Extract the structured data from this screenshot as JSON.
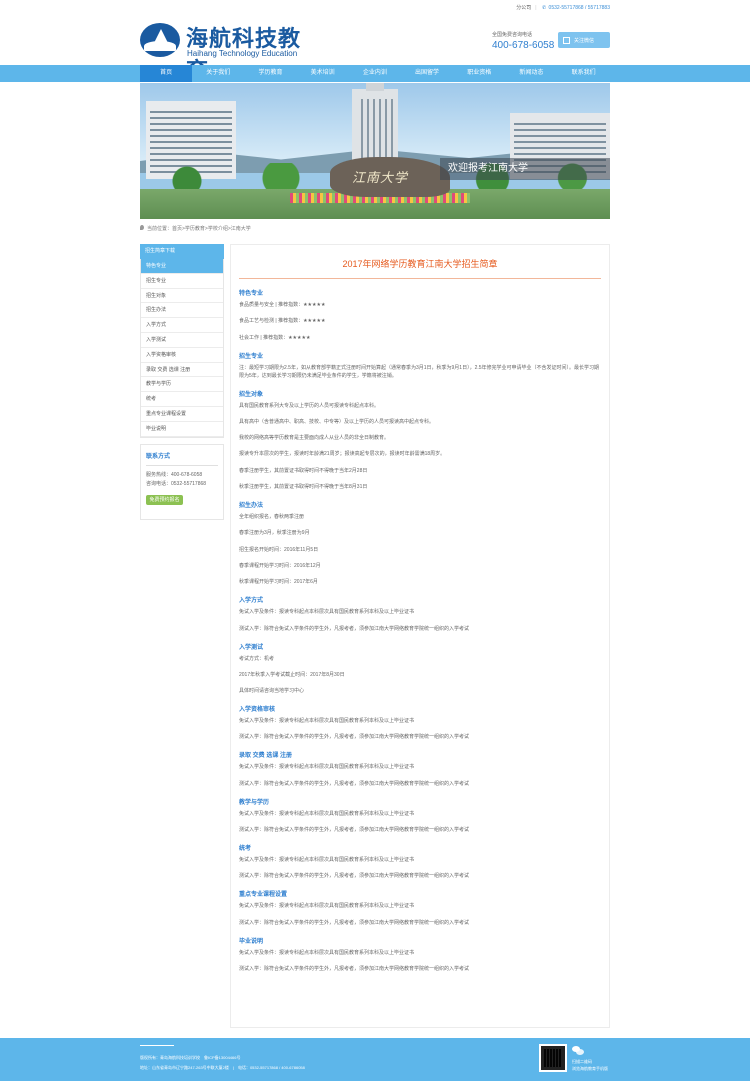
{
  "topbar": {
    "branch": "分公司",
    "tel": "0532-55717868 / 55717883"
  },
  "header": {
    "logo_cn": "海航科技教育",
    "logo_en": "Haihang Technology Education",
    "hotline_label": "全国免费咨询电话",
    "hotline": "400-678-6058",
    "follow": "关注微信"
  },
  "nav": [
    "首页",
    "关于我们",
    "学历教育",
    "美术培训",
    "企业内训",
    "出国留学",
    "职业资格",
    "新闻动态",
    "联系我们"
  ],
  "banner": {
    "calligraphy": "江南大学",
    "welcome": "欢迎报考江南大学"
  },
  "breadcrumb": "当前位置：首页>学历教育>学校介绍>江南大学",
  "sidebar": {
    "download": "招生简章下载",
    "items": [
      "特色专业",
      "招生专业",
      "招生对象",
      "招生办法",
      "入学方式",
      "入学测试",
      "入学资格审核",
      "录取 交费 选课 注册",
      "教学与学历",
      "统考",
      "重点专业课程设置",
      "毕业说明"
    ],
    "contact_title": "联系方式",
    "contact_lines": [
      "服务热线：400-678-6058",
      "咨询电话：0532-55717868"
    ],
    "contact_button": "免费预约报名"
  },
  "article": {
    "title": "2017年网络学历教育江南大学招生简章",
    "sections": [
      {
        "heading": "特色专业",
        "lines": [
          "食品质量与安全 | 推荐指数：★★★★★",
          "食品工艺与检测 | 推荐指数：★★★★★",
          "社会工作 | 推荐指数：★★★★★"
        ]
      },
      {
        "heading": "招生专业",
        "lines": [
          "注：最短学习期限为2.5年，如从教育部学籍正式注册时间开始算起（通常春季为3月1日，秋季为9月1日），2.5年修完学业可申请毕业（不含发证时间）。最长学习期限为5年，达到最长学习期限仍未满足毕业条件的学生，学籍将被注销。"
        ]
      },
      {
        "heading": "招生对象",
        "lines": [
          "具有国民教育系列大专及以上学历的人员可报读专科起点本科。",
          "具有高中（含普通高中、职高、技校、中专等）及以上学历的人员可报读高中起点专科。",
          "我校的网络高等学历教育是主要面向成人从业人员的非全日制教育。",
          "报读专升本层次的学生，报读时年龄满21周岁；报读高起专层次的，报读时年龄需满18周岁。",
          "春季注册学生，其前置证书取得时间不得晚于当年2月28日",
          "秋季注册学生，其前置证书取得时间不得晚于当年8月31日"
        ]
      },
      {
        "heading": "招生办法",
        "lines": [
          "全年组织报名，春秋两季注册",
          "春季注册为3月，秋季注册为9月",
          "招生报名开始时间：2016年11月5日",
          "春季课程开始学习时间：2016年12月",
          "秋季课程开始学习时间：2017年6月"
        ]
      },
      {
        "heading": "入学方式",
        "lines": [
          "免试入学及条件：报读专科起点本科层次具有国民教育系列本科及以上毕业证书",
          "测试入学：除符合免试入学条件的学生外，凡报考者，须参加江南大学网络教育学院统一组织的入学考试"
        ]
      },
      {
        "heading": "入学测试",
        "lines": [
          "考试方式：机考",
          "2017年秋季入学考试截止时间：2017年8月30日",
          "具体时间请咨询当地学习中心"
        ]
      },
      {
        "heading": "入学资格审核",
        "lines": [
          "免试入学及条件：报读专科起点本科层次具有国民教育系列本科及以上毕业证书",
          "测试入学：除符合免试入学条件的学生外，凡报考者，须参加江南大学网络教育学院统一组织的入学考试"
        ]
      },
      {
        "heading": "录取 交费 选课 注册",
        "lines": [
          "免试入学及条件：报读专科起点本科层次具有国民教育系列本科及以上毕业证书",
          "测试入学：除符合免试入学条件的学生外，凡报考者，须参加江南大学网络教育学院统一组织的入学考试"
        ]
      },
      {
        "heading": "教学与学历",
        "lines": [
          "免试入学及条件：报读专科起点本科层次具有国民教育系列本科及以上毕业证书",
          "测试入学：除符合免试入学条件的学生外，凡报考者，须参加江南大学网络教育学院统一组织的入学考试"
        ]
      },
      {
        "heading": "统考",
        "lines": [
          "免试入学及条件：报读专科起点本科层次具有国民教育系列本科及以上毕业证书",
          "测试入学：除符合免试入学条件的学生外，凡报考者，须参加江南大学网络教育学院统一组织的入学考试"
        ]
      },
      {
        "heading": "重点专业课程设置",
        "lines": [
          "免试入学及条件：报读专科起点本科层次具有国民教育系列本科及以上毕业证书",
          "测试入学：除符合免试入学条件的学生外，凡报考者，须参加江南大学网络教育学院统一组织的入学考试"
        ]
      },
      {
        "heading": "毕业说明",
        "lines": [
          "免试入学及条件：报读专科起点本科层次具有国民教育系列本科及以上毕业证书",
          "测试入学：除符合免试入学条件的学生外，凡报考者，须参加江南大学网络教育学院统一组织的入学考试"
        ]
      }
    ]
  },
  "footer": {
    "line1": "版权所有：青岛海航科技培训学校　鲁ICP备13004466号",
    "line2": "地址：山东省青岛市辽宁路247-263号中联大厦2楼　|　电话：0532-55717868 / 400-6786058",
    "qr_line1": "扫描二维码",
    "qr_line2": "浏览海航教育手机版"
  }
}
